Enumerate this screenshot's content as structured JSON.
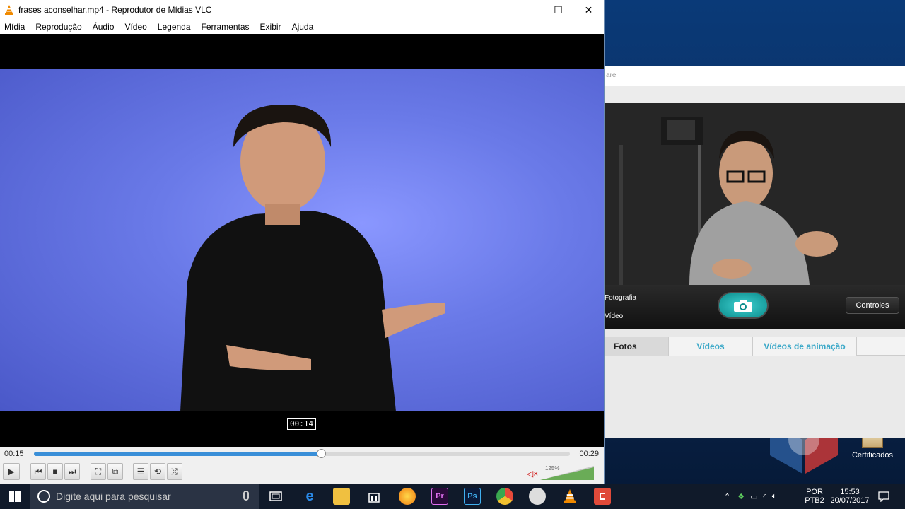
{
  "vlc": {
    "title": "frases aconselhar.mp4 - Reprodutor de Mídias VLC",
    "window_controls": {
      "minimize": "—",
      "maximize": "☐",
      "close": "✕"
    },
    "menu": [
      "Mídia",
      "Reprodução",
      "Áudio",
      "Vídeo",
      "Legenda",
      "Ferramentas",
      "Exibir",
      "Ajuda"
    ],
    "seek_tooltip": "00:14",
    "elapsed": "00:15",
    "total": "00:29",
    "progress": 0.535,
    "volume_percent": "125%",
    "controls": {
      "play": "▶",
      "prev": "⏮",
      "stop": "■",
      "next": "⏭",
      "fullscreen": "⛶",
      "extended": "⧉",
      "playlist": "☰",
      "loop": "⟲",
      "random": "⤮"
    }
  },
  "camera_app": {
    "search_placeholder": "are",
    "mode_photo": "Fotografia",
    "mode_video": "Vídeo",
    "controls_button": "Controles",
    "tabs": [
      "Fotos",
      "Vídeos",
      "Vídeos de animação"
    ],
    "active_tab": 0
  },
  "desktop": {
    "icon_label": "Certificados"
  },
  "taskbar": {
    "search_placeholder": "Digite aqui para pesquisar",
    "lang_top": "POR",
    "lang_bottom": "PTB2",
    "time": "15:53",
    "date": "20/07/2017",
    "pinned_icons": [
      "task-view-icon",
      "edge-icon",
      "file-explorer-icon",
      "store-icon",
      "firefox-icon",
      "premiere-icon",
      "photoshop-icon",
      "chrome-icon",
      "webcam-icon",
      "vlc-icon",
      "red-app-icon"
    ]
  },
  "colors": {
    "seek_fill": "#3a8fd8",
    "shutter": "#1aa8a8",
    "tab_link": "#3aa8c8"
  }
}
